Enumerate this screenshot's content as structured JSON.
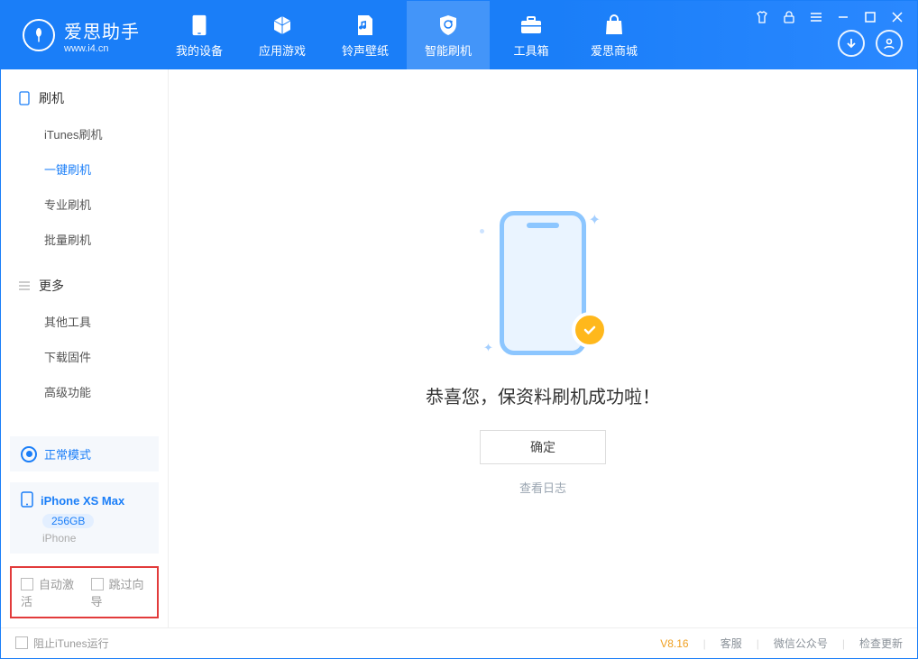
{
  "brand": {
    "name": "爱思助手",
    "url": "www.i4.cn"
  },
  "nav": {
    "tabs": [
      {
        "label": "我的设备",
        "icon": "device"
      },
      {
        "label": "应用游戏",
        "icon": "apps"
      },
      {
        "label": "铃声壁纸",
        "icon": "ringtone"
      },
      {
        "label": "智能刷机",
        "icon": "flash",
        "active": true
      },
      {
        "label": "工具箱",
        "icon": "toolbox"
      },
      {
        "label": "爱思商城",
        "icon": "store"
      }
    ]
  },
  "sidebar": {
    "groups": [
      {
        "title": "刷机",
        "icon": "phone",
        "items": [
          {
            "label": "iTunes刷机"
          },
          {
            "label": "一键刷机",
            "active": true
          },
          {
            "label": "专业刷机"
          },
          {
            "label": "批量刷机"
          }
        ]
      },
      {
        "title": "更多",
        "icon": "more",
        "items": [
          {
            "label": "其他工具"
          },
          {
            "label": "下载固件"
          },
          {
            "label": "高级功能"
          }
        ]
      }
    ],
    "status": {
      "label": "正常模式"
    },
    "device": {
      "name": "iPhone XS Max",
      "storage": "256GB",
      "type": "iPhone"
    },
    "options": {
      "auto_activate": "自动激活",
      "skip_guide": "跳过向导"
    }
  },
  "main": {
    "success_message": "恭喜您，保资料刷机成功啦！",
    "ok": "确定",
    "view_log": "查看日志"
  },
  "footer": {
    "block_itunes": "阻止iTunes运行",
    "version": "V8.16",
    "links": {
      "service": "客服",
      "wechat": "微信公众号",
      "update": "检查更新"
    }
  }
}
